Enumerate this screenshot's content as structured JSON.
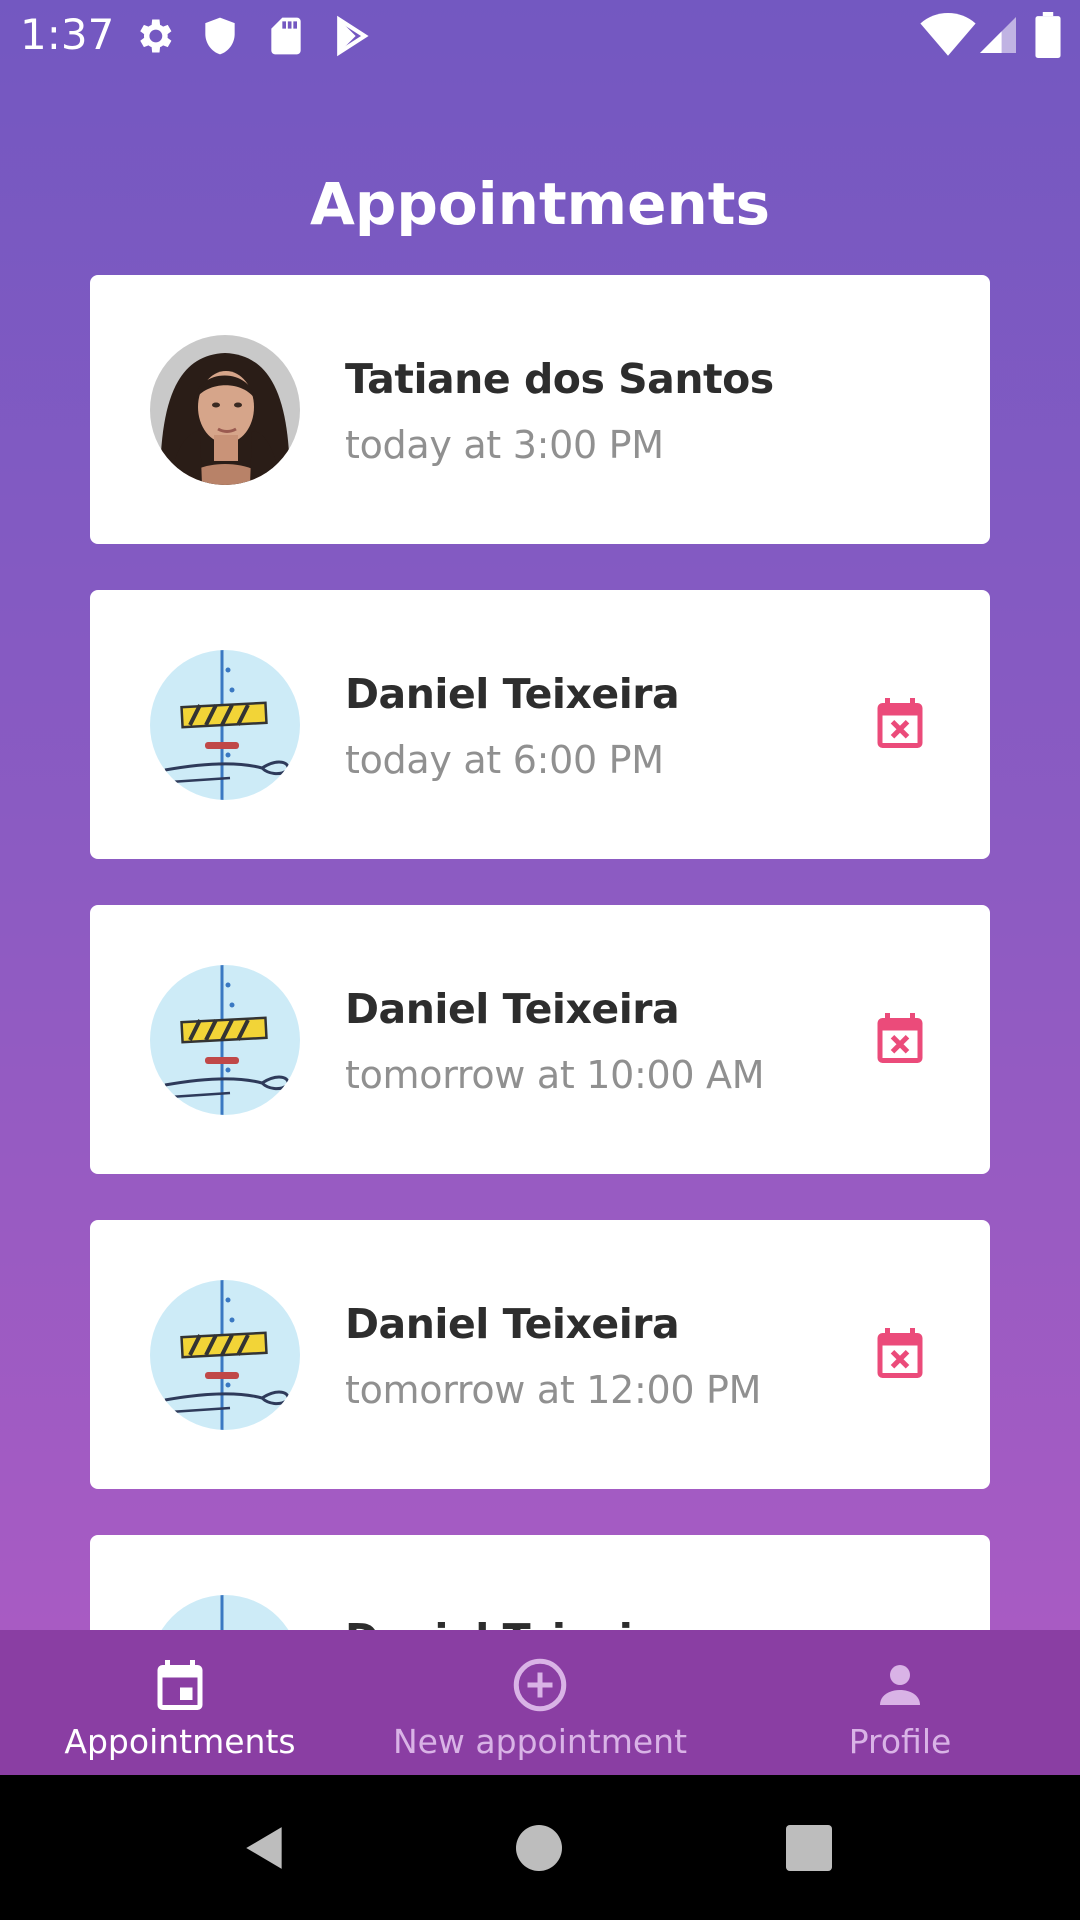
{
  "status_bar": {
    "time": "1:37",
    "left_icons": [
      "gear-icon",
      "shield-icon",
      "sd-card-icon",
      "play-store-icon"
    ],
    "right_icons": [
      "wifi-icon",
      "cell-signal-icon",
      "battery-icon"
    ]
  },
  "page": {
    "title": "Appointments"
  },
  "appointments": [
    {
      "name": "Tatiane dos Santos",
      "when": "today at 3:00 PM",
      "avatar": "person-photo",
      "cancelable": false
    },
    {
      "name": "Daniel Teixeira",
      "when": "today at 6:00 PM",
      "avatar": "construction-illustration",
      "cancelable": true
    },
    {
      "name": "Daniel Teixeira",
      "when": "tomorrow at 10:00 AM",
      "avatar": "construction-illustration",
      "cancelable": true
    },
    {
      "name": "Daniel Teixeira",
      "when": "tomorrow at 12:00 PM",
      "avatar": "construction-illustration",
      "cancelable": true
    },
    {
      "name": "Daniel Teixeira",
      "when": "",
      "avatar": "construction-illustration",
      "cancelable": true
    }
  ],
  "bottom_nav": {
    "tabs": [
      {
        "label": "Appointments",
        "icon": "calendar-icon",
        "active": true
      },
      {
        "label": "New appointment",
        "icon": "add-circle-icon",
        "active": false
      },
      {
        "label": "Profile",
        "icon": "person-icon",
        "active": false
      }
    ]
  },
  "colors": {
    "gradient_top": "#7358C1",
    "gradient_bottom": "#AA5CC3",
    "nav_background": "#8A3EA3",
    "cancel_icon": "#EB4B7A",
    "name_text": "#2D2D2D",
    "time_text": "#909090"
  }
}
